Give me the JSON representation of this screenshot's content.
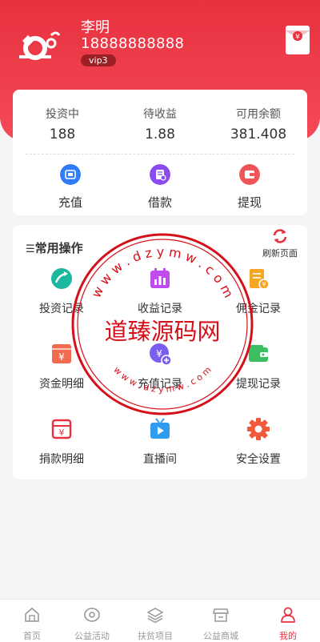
{
  "user": {
    "name": "李明",
    "phone": "18888888888",
    "vip": "vip3"
  },
  "stats": [
    {
      "label": "投资中",
      "value": "188"
    },
    {
      "label": "待收益",
      "value": "1.88"
    },
    {
      "label": "可用余额",
      "value": "381.408"
    }
  ],
  "actions": [
    {
      "label": "充值",
      "icon": "wallet-icon",
      "color": "#2f7cf6"
    },
    {
      "label": "借款",
      "icon": "loan-doc-icon",
      "color": "#8a4cf0"
    },
    {
      "label": "提现",
      "icon": "withdraw-icon",
      "color": "#f0555a"
    }
  ],
  "common": {
    "title": "常用操作",
    "refresh_label": "刷新页面",
    "items": [
      {
        "label": "投资记录",
        "icon": "invest-trend-icon",
        "color": "#1bb8a0"
      },
      {
        "label": "收益记录",
        "icon": "calendar-chart-icon",
        "color": "#c04cf0"
      },
      {
        "label": "佣金记录",
        "icon": "commission-icon",
        "color": "#f5a623"
      },
      {
        "label": "资金明细",
        "icon": "yen-box-icon",
        "color": "#f26b50"
      },
      {
        "label": "充值记录",
        "icon": "recharge-yen-icon",
        "color": "#7a5cf0"
      },
      {
        "label": "提现记录",
        "icon": "wallet-green-icon",
        "color": "#3cbf62"
      },
      {
        "label": "捐款明细",
        "icon": "donation-box-icon",
        "color": "#e8313f"
      },
      {
        "label": "直播间",
        "icon": "tv-play-icon",
        "color": "#2f9cf0"
      },
      {
        "label": "安全设置",
        "icon": "gear-icon",
        "color": "#f25a3c"
      }
    ]
  },
  "watermark": {
    "text": "道臻源码网",
    "ring_top": "w w w . d z y m w . c o m",
    "ring_bottom": "w w w . d z y m w . c o m"
  },
  "tabs": [
    {
      "label": "首页",
      "icon": "home-icon"
    },
    {
      "label": "公益活动",
      "icon": "eye-icon"
    },
    {
      "label": "扶贫项目",
      "icon": "layers-icon"
    },
    {
      "label": "公益商城",
      "icon": "shop-icon"
    },
    {
      "label": "我的",
      "icon": "user-icon",
      "active": true
    }
  ],
  "colors": {
    "brand": "#e8313f"
  }
}
